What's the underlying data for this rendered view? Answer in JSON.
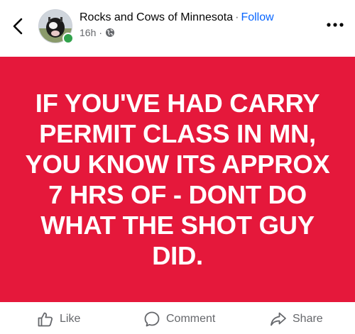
{
  "header": {
    "page_name": "Rocks and Cows of Minnesota",
    "separator": "·",
    "follow_label": "Follow",
    "time_ago": "16h",
    "meta_separator": "·",
    "audience_icon": "globe-icon",
    "back_icon": "chevron-left-icon",
    "more_icon": "more-horizontal-icon"
  },
  "post": {
    "text": "IF YOU'VE HAD CARRY\nPERMIT CLASS IN MN,\nYOU KNOW ITS APPROX\n7 HRS OF - DONT DO\nWHAT THE SHOT GUY\nDID.",
    "background_color": "#e5183b",
    "text_color": "#ffffff"
  },
  "actions": {
    "like_label": "Like",
    "comment_label": "Comment",
    "share_label": "Share",
    "like_icon": "thumbs-up-icon",
    "comment_icon": "speech-bubble-icon",
    "share_icon": "share-arrow-icon"
  },
  "colors": {
    "accent": "#0866ff",
    "online": "#31a24c",
    "secondary_text": "#65676b"
  }
}
